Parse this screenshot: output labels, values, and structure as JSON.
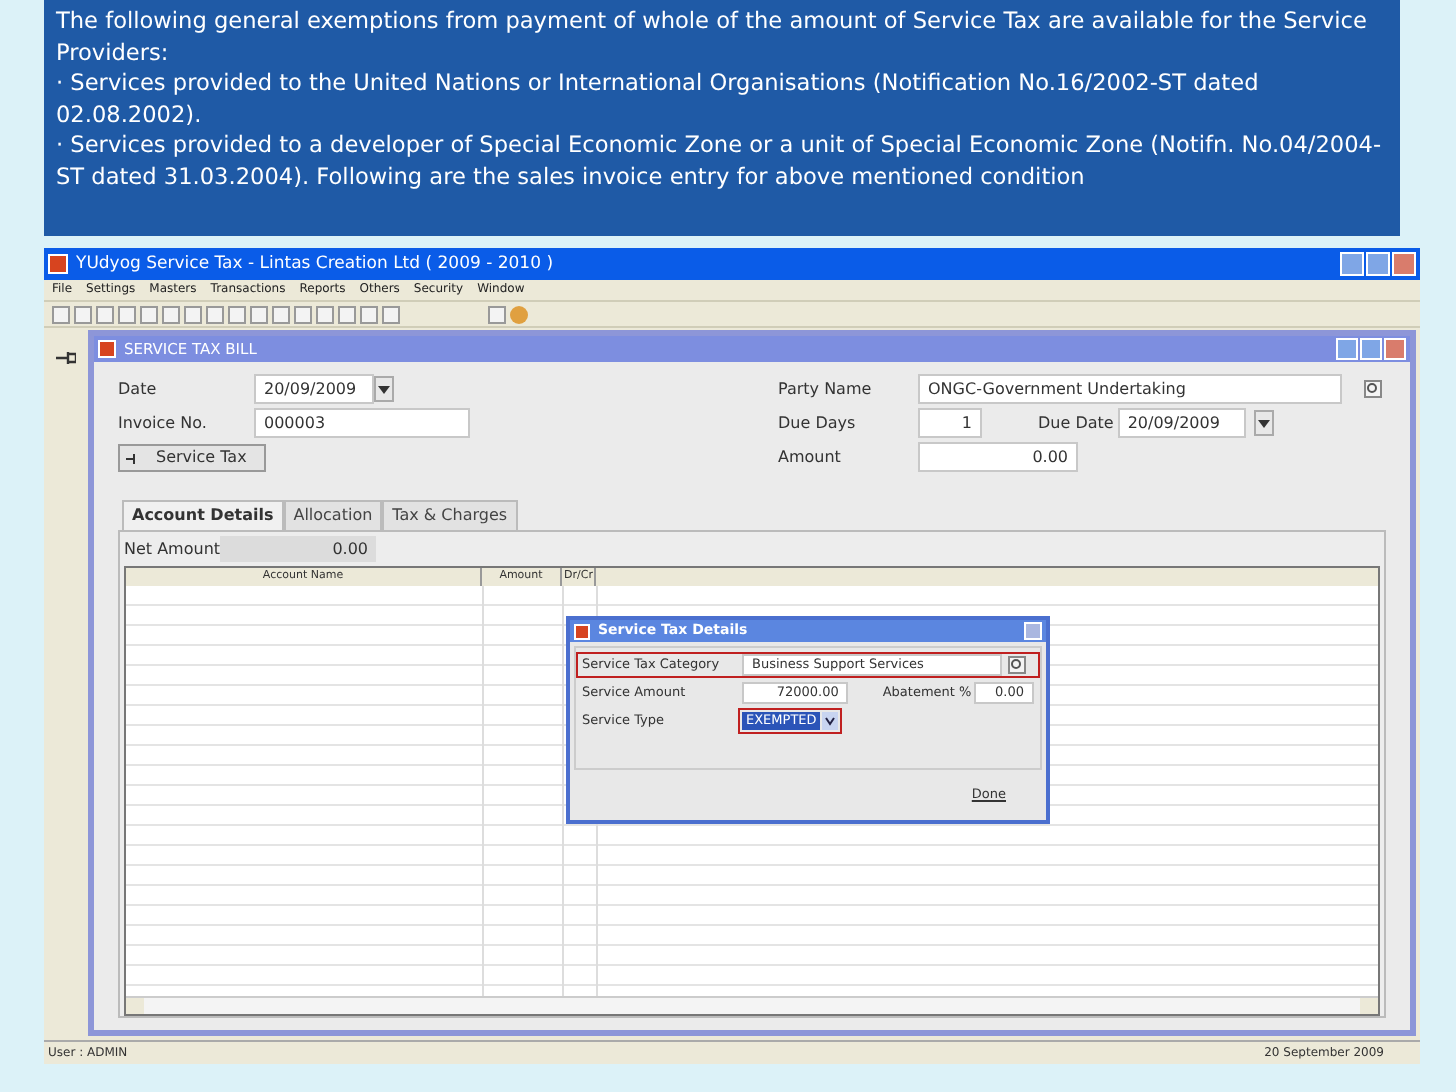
{
  "note": {
    "paragraphs": [
      "The following general exemptions from payment of whole of the amount of Service Tax are available for the Service Providers:",
      "· Services provided to the United Nations or International Organisations (Notification No.16/2002-ST dated 02.08.2002).",
      "· Services provided to a developer of Special Economic Zone or a unit of Special Economic Zone (Notifn. No.04/2004-ST dated 31.03.2004). Following are the sales invoice entry for above mentioned condition"
    ]
  },
  "window": {
    "title": "YUdyog Service Tax  -  Lintas Creation Ltd ( 2009 - 2010 )"
  },
  "menu": [
    "File",
    "Settings",
    "Masters",
    "Transactions",
    "Reports",
    "Others",
    "Security",
    "Window"
  ],
  "child": {
    "title": "SERVICE TAX BILL",
    "date": {
      "label": "Date",
      "value": "20/09/2009"
    },
    "invoice": {
      "label": "Invoice No.",
      "value": "000003"
    },
    "service_tax_button": "Service Tax",
    "party": {
      "label": "Party Name",
      "value": "ONGC-Government Undertaking"
    },
    "due_days": {
      "label": "Due Days",
      "value": "1"
    },
    "due_date": {
      "label": "Due Date",
      "value": "20/09/2009"
    },
    "amount": {
      "label": "Amount",
      "value": "0.00"
    },
    "tabs": [
      {
        "label": "Account Details",
        "selected": true
      },
      {
        "label": "Allocation",
        "selected": false
      },
      {
        "label": "Tax & Charges",
        "selected": false
      }
    ],
    "net_amount": {
      "label": "Net Amount",
      "value": "0.00"
    },
    "table": {
      "columns": [
        "Account Name",
        "Amount",
        "Dr/Cr"
      ]
    }
  },
  "dialog": {
    "title": "Service Tax Details",
    "category": {
      "label": "Service Tax Category",
      "value": "Business Support Services",
      "highlighted": true
    },
    "service_amount": {
      "label": "Service Amount",
      "value": "72000.00"
    },
    "abatement": {
      "label": "Abatement %",
      "value": "0.00"
    },
    "service_type": {
      "label": "Service Type",
      "value": "EXEMPTED",
      "highlighted": true
    },
    "done": "Done"
  },
  "status_bar": {
    "user": "User : ADMIN",
    "date": "20 September 2009"
  }
}
